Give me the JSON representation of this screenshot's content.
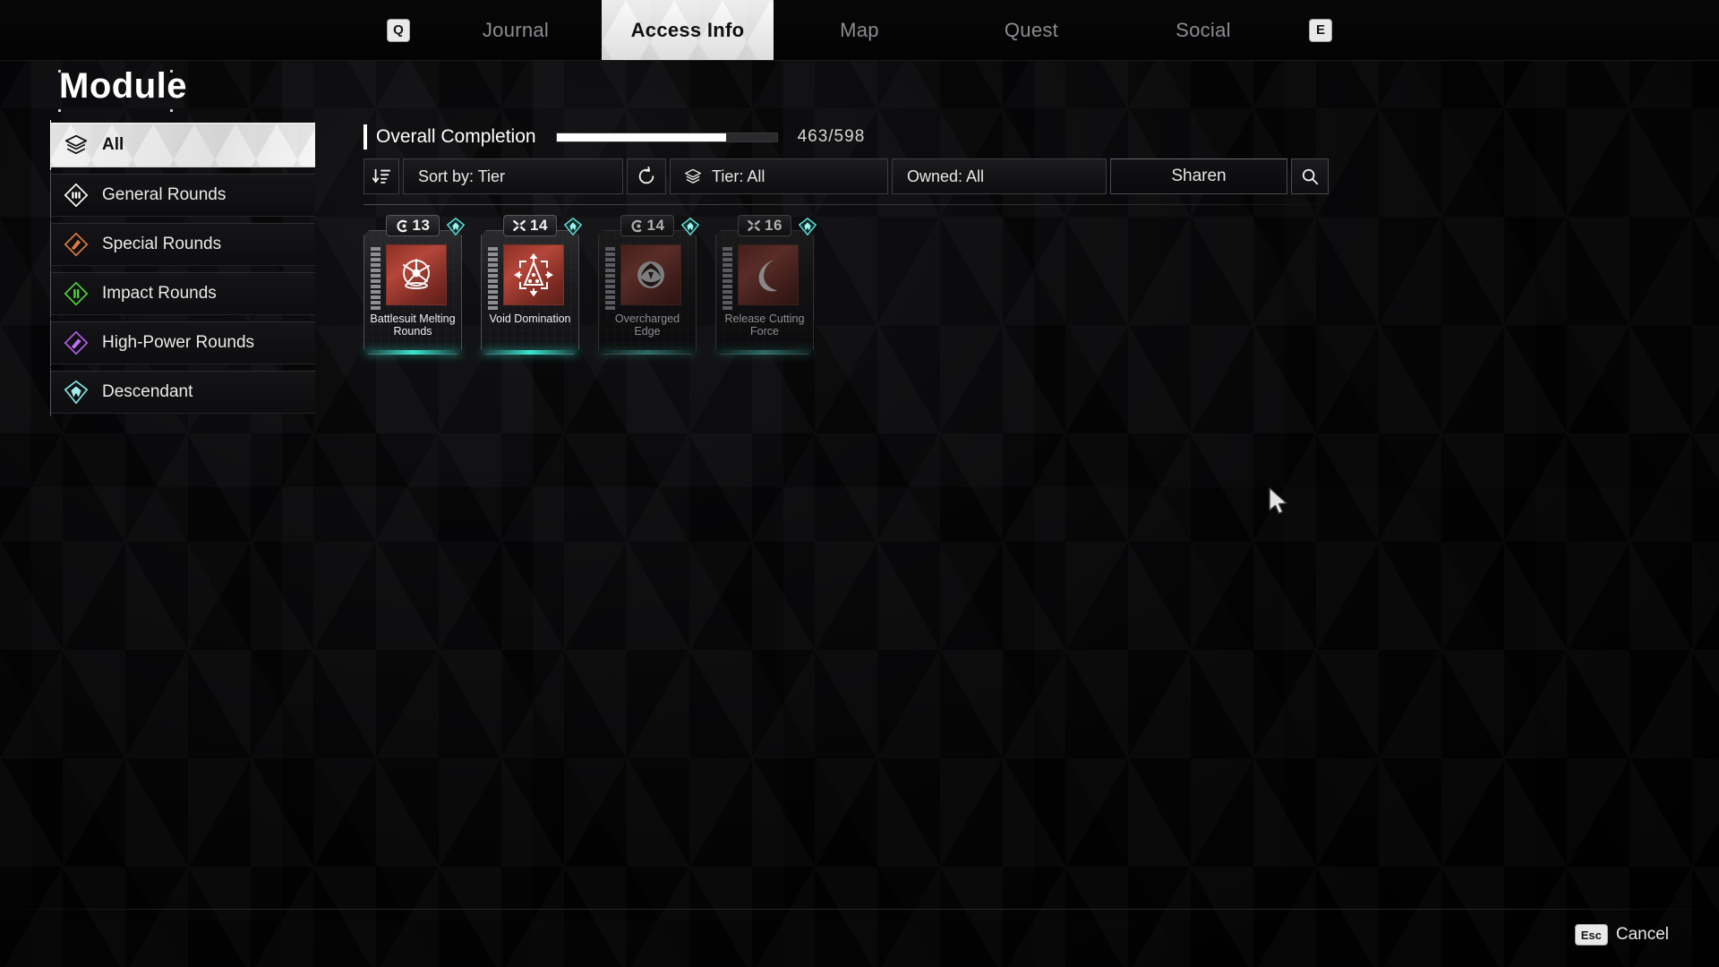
{
  "nav": {
    "left_key": "Q",
    "right_key": "E",
    "items": [
      {
        "label": "Journal",
        "active": false
      },
      {
        "label": "Access Info",
        "active": true
      },
      {
        "label": "Map",
        "active": false
      },
      {
        "label": "Quest",
        "active": false
      },
      {
        "label": "Social",
        "active": false
      }
    ]
  },
  "page": {
    "title": "Module"
  },
  "sidebar": {
    "items": [
      {
        "label": "All",
        "icon": "layers-icon",
        "color": "#f0f0f0",
        "active": true
      },
      {
        "label": "General Rounds",
        "icon": "general-rounds-diamond-icon",
        "color": "#ffffff",
        "active": false
      },
      {
        "label": "Special Rounds",
        "icon": "special-rounds-diamond-icon",
        "color": "#e07b3c",
        "active": false
      },
      {
        "label": "Impact Rounds",
        "icon": "impact-rounds-diamond-icon",
        "color": "#4fd23a",
        "active": false
      },
      {
        "label": "High-Power Rounds",
        "icon": "high-power-rounds-diamond-icon",
        "color": "#b martin",
        "active": false
      },
      {
        "label": "Descendant",
        "icon": "descendant-diamond-icon",
        "color": "#7fe3e0",
        "active": false
      }
    ]
  },
  "completion": {
    "label": "Overall Completion",
    "count": "463/598",
    "current": 463,
    "total": 598,
    "percent": 77
  },
  "toolbar": {
    "sort_label": "Sort by: Tier",
    "sort_icon": "sort-descending-icon",
    "reset_icon": "reset-icon",
    "tier_label": "Tier: All",
    "tier_icon": "layers-icon",
    "owned_label": "Owned: All",
    "search_value": "Sharen",
    "search_icon": "search-icon"
  },
  "cards": [
    {
      "name": "Battlesuit Melting Rounds",
      "cost": "13",
      "cost_icon": "capacity-c-icon",
      "socket_icon": "socket-diamond-icon",
      "glyph": "shattered-sphere-icon",
      "owned": true,
      "segments": 12
    },
    {
      "name": "Void Domination",
      "cost": "14",
      "cost_icon": "capacity-x-icon",
      "socket_icon": "socket-diamond-icon",
      "glyph": "spread-triangle-icon",
      "owned": true,
      "segments": 12
    },
    {
      "name": "Overcharged Edge",
      "cost": "14",
      "cost_icon": "capacity-c-icon",
      "socket_icon": "socket-diamond-icon",
      "glyph": "orb-creature-icon",
      "owned": false,
      "segments": 12
    },
    {
      "name": "Release Cutting Force",
      "cost": "16",
      "cost_icon": "capacity-x-icon",
      "socket_icon": "socket-diamond-icon",
      "glyph": "crescent-moon-icon",
      "owned": false,
      "segments": 12
    }
  ],
  "footer": {
    "key": "Esc",
    "label": "Cancel"
  }
}
